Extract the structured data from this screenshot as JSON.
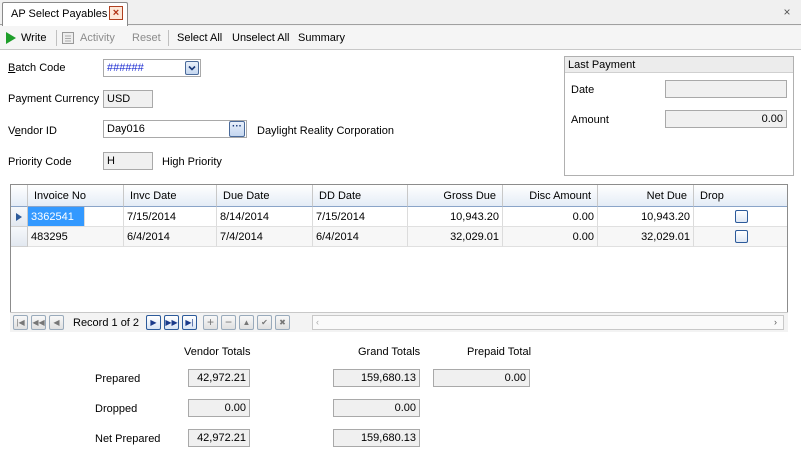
{
  "tab": {
    "title": "AP Select Payables"
  },
  "toolbar": {
    "write": "Write",
    "activity": "Activity",
    "reset": "Reset",
    "select_all": "Select All",
    "unselect_all": "Unselect All",
    "summary": "Summary"
  },
  "form": {
    "batch_code_label": "Batch Code",
    "batch_code_value": "######",
    "payment_currency_label": "Payment Currency",
    "payment_currency_value": "USD",
    "vendor_id_label": "Vendor ID",
    "vendor_id_value": "Day016",
    "vendor_name": "Daylight Reality Corporation",
    "priority_code_label": "Priority Code",
    "priority_code_value": "H",
    "priority_desc": "High Priority"
  },
  "last_payment": {
    "title": "Last Payment",
    "date_label": "Date",
    "date_value": "",
    "amount_label": "Amount",
    "amount_value": "0.00"
  },
  "grid": {
    "columns": [
      "Invoice No",
      "Invc Date",
      "Due Date",
      "DD Date",
      "Gross Due",
      "Disc Amount",
      "Net Due",
      "Drop"
    ],
    "rows": [
      {
        "invoice_no": "3362541",
        "invc_date": "7/15/2014",
        "due_date": "8/14/2014",
        "dd_date": "7/15/2014",
        "gross_due": "10,943.20",
        "disc_amount": "0.00",
        "net_due": "10,943.20",
        "drop": false
      },
      {
        "invoice_no": "483295",
        "invc_date": "6/4/2014",
        "due_date": "7/4/2014",
        "dd_date": "6/4/2014",
        "gross_due": "32,029.01",
        "disc_amount": "0.00",
        "net_due": "32,029.01",
        "drop": false
      }
    ],
    "record_text": "Record 1 of 2"
  },
  "totals": {
    "vendor_totals_label": "Vendor Totals",
    "grand_totals_label": "Grand Totals",
    "prepaid_total_label": "Prepaid Total",
    "prepared_label": "Prepared",
    "dropped_label": "Dropped",
    "net_prepared_label": "Net Prepared",
    "vendor_prepared": "42,972.21",
    "vendor_dropped": "0.00",
    "vendor_net_prepared": "42,972.21",
    "grand_prepared": "159,680.13",
    "grand_dropped": "0.00",
    "grand_net_prepared": "159,680.13",
    "prepaid_total": "0.00"
  },
  "colors": {
    "accent": "#3399ff",
    "write_icon": "#1e9e2a"
  },
  "icons": {
    "write": "play-icon",
    "activity": "activity-icon",
    "tab_close": "close-icon",
    "window_close": "close-icon",
    "batch_dropdown": "chevron-down-icon",
    "vendor_lookup": "ellipsis-icon"
  }
}
